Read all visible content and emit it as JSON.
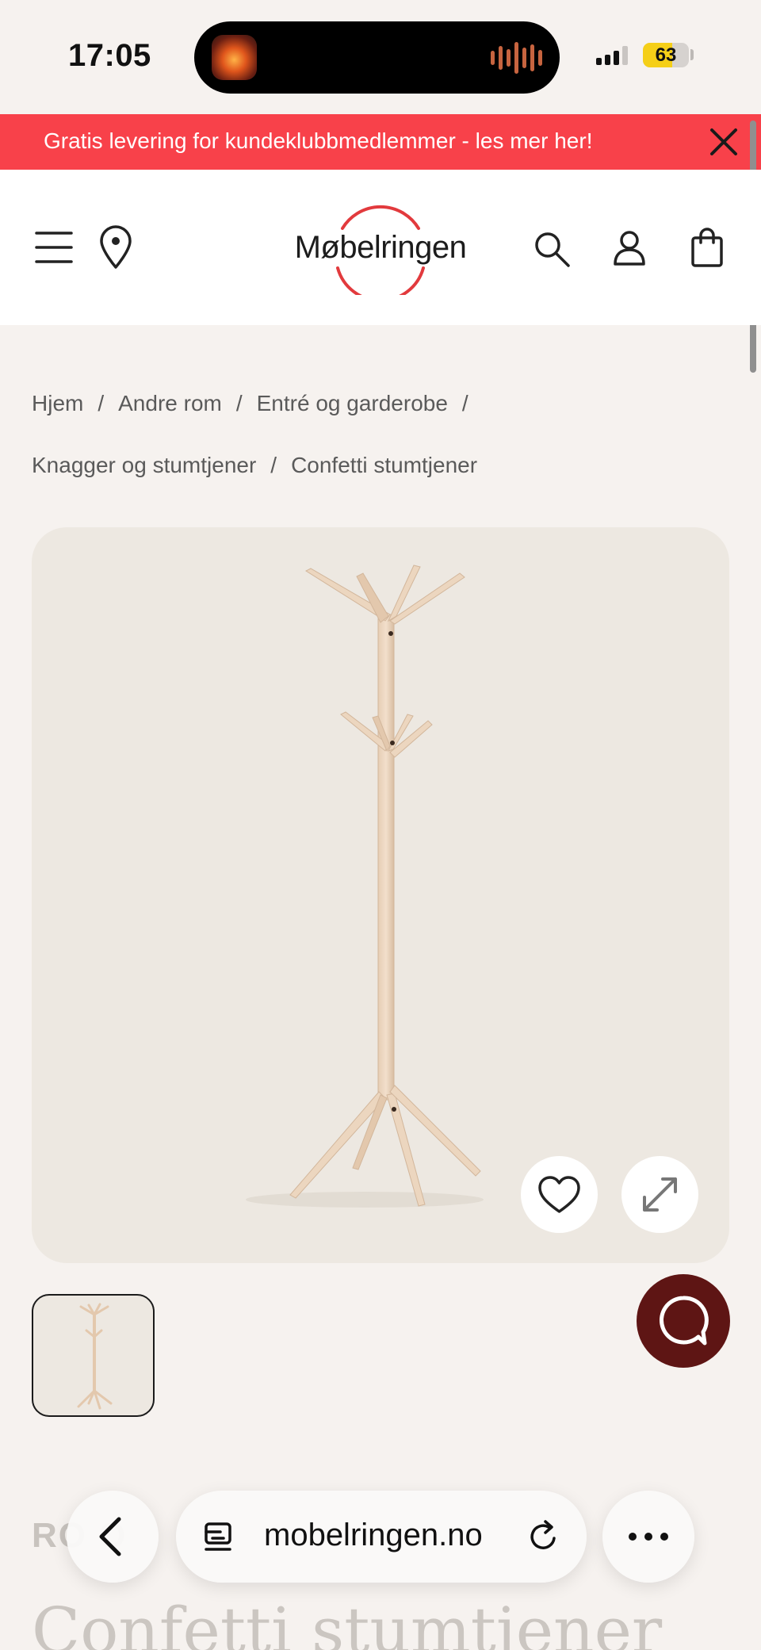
{
  "status_bar": {
    "time": "17:05",
    "battery_level": "63",
    "battery_percent": 63,
    "icons": [
      "now-playing-app-icon",
      "audio-waveform-icon",
      "cellular-signal-icon",
      "battery-icon"
    ]
  },
  "banner": {
    "text": "Gratis levering for kundeklubbmedlemmer - les mer her!",
    "background_color": "#f8414a",
    "close_icon": "close-icon"
  },
  "header": {
    "logo_text": "Møbelringen",
    "brand_color": "#e23a3d",
    "icons": [
      "menu-icon",
      "location-pin-icon",
      "search-icon",
      "user-icon",
      "shopping-bag-icon"
    ]
  },
  "breadcrumb": {
    "items": [
      "Hjem",
      "Andre rom",
      "Entré og garderobe",
      "Knagger og stumtjener",
      "Confetti stumtjener"
    ],
    "separator": "/"
  },
  "product": {
    "image_subject": "coat-stand",
    "actions": [
      "heart-icon",
      "expand-icon"
    ],
    "thumbnail_count": 1,
    "brand": "RO O",
    "title": "Confetti stumtjener"
  },
  "chat": {
    "icon": "chat-icon",
    "color": "#5e1514"
  },
  "browser_bar": {
    "url": "mobelringen.no",
    "icons": [
      "back-chevron-icon",
      "page-menu-icon",
      "reload-icon",
      "more-icon"
    ]
  }
}
